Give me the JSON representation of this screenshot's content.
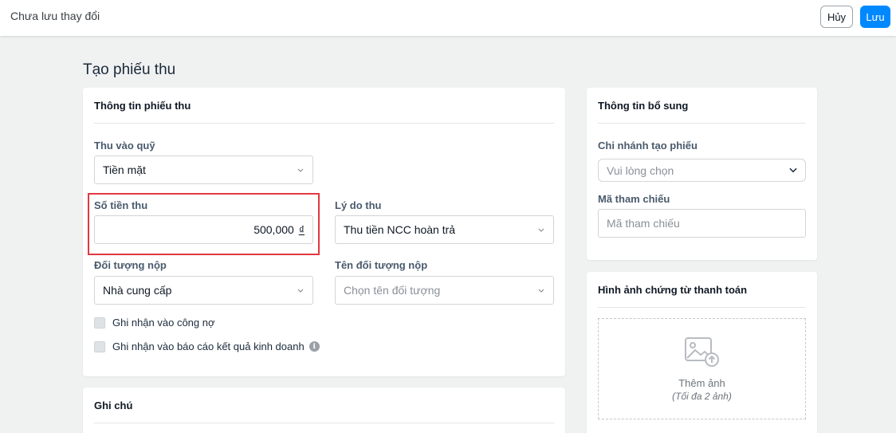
{
  "topbar": {
    "title": "Chưa lưu thay đổi",
    "cancel_label": "Hủy",
    "save_label": "Lưu"
  },
  "page": {
    "title": "Tạo phiếu thu"
  },
  "receipt_info": {
    "title": "Thông tin phiếu thu",
    "fund": {
      "label": "Thu vào quỹ",
      "value": "Tiền mặt"
    },
    "amount": {
      "label": "Số tiền thu",
      "value": "500,000",
      "currency": "₫"
    },
    "reason": {
      "label": "Lý do thu",
      "value": "Thu tiền NCC hoàn trả"
    },
    "payer_type": {
      "label": "Đối tượng nộp",
      "value": "Nhà cung cấp"
    },
    "payer_name": {
      "label": "Tên đối tượng nộp",
      "placeholder": "Chọn tên đối tượng"
    },
    "checkbox_debt": {
      "label": "Ghi nhận vào công nợ",
      "checked": false
    },
    "checkbox_report": {
      "label": "Ghi nhận vào báo cáo kết quả kinh doanh",
      "checked": false
    }
  },
  "notes": {
    "title": "Ghi chú"
  },
  "additional_info": {
    "title": "Thông tin bổ sung",
    "branch": {
      "label": "Chi nhánh tạo phiếu",
      "placeholder": "Vui lòng chọn"
    },
    "reference": {
      "label": "Mã tham chiếu",
      "placeholder": "Mã tham chiếu"
    }
  },
  "proof_images": {
    "title": "Hình ảnh chứng từ thanh toán",
    "add_label": "Thêm ảnh",
    "limit_label": "(Tối đa 2 ảnh)"
  },
  "icons": {
    "chevron": "chevron-down-icon",
    "info": "info-icon",
    "upload": "image-upload-icon"
  },
  "colors": {
    "primary": "#0088ff",
    "highlight": "#e2383f",
    "background": "#f0f1f1"
  }
}
